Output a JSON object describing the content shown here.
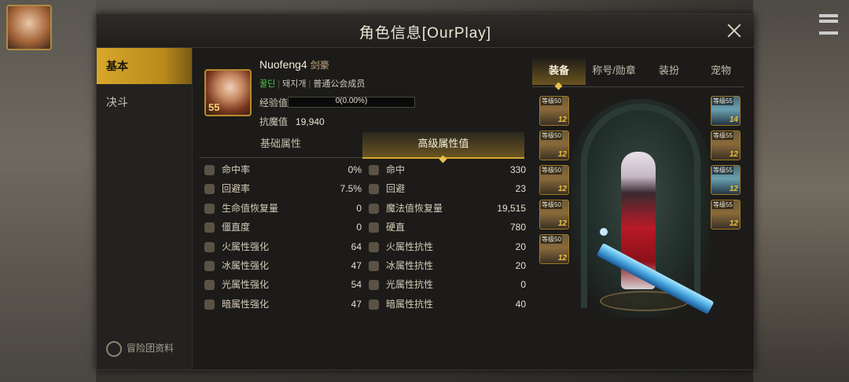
{
  "window": {
    "title": "角色信息[OurPlay]"
  },
  "nav": {
    "items": [
      {
        "label": "基本",
        "active": true
      },
      {
        "label": "决斗",
        "active": false
      }
    ],
    "footer_label": "冒险团资料"
  },
  "character": {
    "level": "55",
    "name": "Nuofeng4",
    "class": "剑豪",
    "tag": "꿀딘",
    "guild": "돼지개",
    "guild_role": "普通公会成员",
    "exp_label": "经验值",
    "exp_text": "0(0.00%)",
    "exp_fraction": 0,
    "resist_label": "抗魔值",
    "resist_value": "19,940"
  },
  "stat_tabs": [
    {
      "label": "基础属性",
      "active": false
    },
    {
      "label": "高级属性值",
      "active": true
    }
  ],
  "stats_left": [
    {
      "name": "命中率",
      "value": "0%"
    },
    {
      "name": "回避率",
      "value": "7.5%"
    },
    {
      "name": "生命值恢复量",
      "value": "0"
    },
    {
      "name": "僵直度",
      "value": "0"
    },
    {
      "name": "火属性强化",
      "value": "64"
    },
    {
      "name": "冰属性强化",
      "value": "47"
    },
    {
      "name": "光属性强化",
      "value": "54"
    },
    {
      "name": "暗属性强化",
      "value": "47"
    }
  ],
  "stats_right": [
    {
      "name": "命中",
      "value": "330"
    },
    {
      "name": "回避",
      "value": "23"
    },
    {
      "name": "魔法值恢复量",
      "value": "19,515"
    },
    {
      "name": "硬直",
      "value": "780"
    },
    {
      "name": "火属性抗性",
      "value": "20"
    },
    {
      "name": "冰属性抗性",
      "value": "20"
    },
    {
      "name": "光属性抗性",
      "value": "0"
    },
    {
      "name": "暗属性抗性",
      "value": "40"
    }
  ],
  "equip_tabs": [
    {
      "label": "装备",
      "active": true
    },
    {
      "label": "称号/勋章",
      "active": false
    },
    {
      "label": "装扮",
      "active": false
    },
    {
      "label": "宠物",
      "active": false
    }
  ],
  "equip_left": [
    {
      "level": "等级50",
      "upgrade": "12"
    },
    {
      "level": "等级50",
      "upgrade": "12"
    },
    {
      "level": "等级50",
      "upgrade": "12"
    },
    {
      "level": "等级50",
      "upgrade": "12"
    },
    {
      "level": "等级50",
      "upgrade": "12"
    }
  ],
  "equip_right": [
    {
      "level": "等级55",
      "upgrade": "14"
    },
    {
      "level": "等级55",
      "upgrade": "12"
    },
    {
      "level": "等级55",
      "upgrade": "12"
    },
    {
      "level": "等级55",
      "upgrade": "12"
    }
  ]
}
